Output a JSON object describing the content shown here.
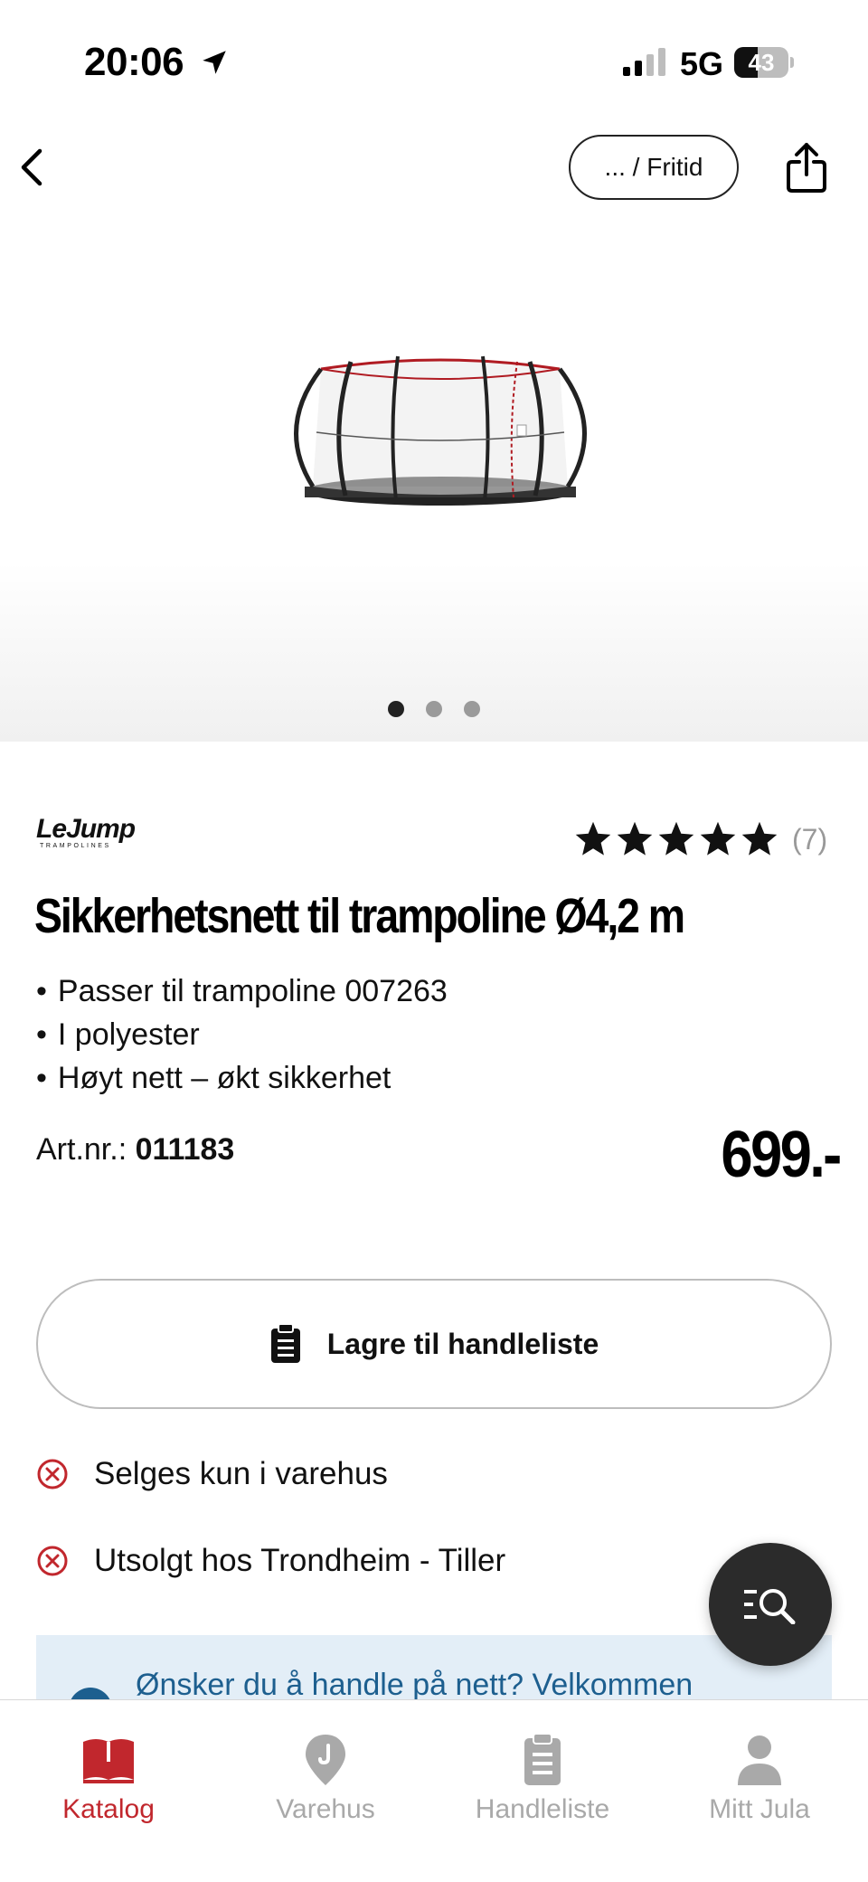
{
  "status_bar": {
    "time": "20:06",
    "network": "5G",
    "battery": "43",
    "battery_level": 0.43
  },
  "header": {
    "breadcrumb": "... / Fritid"
  },
  "gallery": {
    "image_count": 3,
    "active_index": 0
  },
  "product": {
    "brand": "LeJump",
    "brand_sub": "TRAMPOLINES",
    "rating": 5,
    "review_count": "(7)",
    "title": "Sikkerhetsnett til trampoline Ø4,2 m",
    "bullets": [
      "Passer til trampoline 007263",
      "I polyester",
      "Høyt nett – økt sikkerhet"
    ],
    "artnr_label": "Art.nr.:",
    "artnr_value": "011183",
    "price": "699.-"
  },
  "save_button": {
    "label": "Lagre til handleliste"
  },
  "availability": [
    {
      "text": "Selges kun i varehus",
      "status": "unavailable"
    },
    {
      "text": "Utsolgt hos Trondheim - Tiller",
      "status": "unavailable"
    }
  ],
  "info_banner": {
    "text": "Ønsker du å handle på nett? Velkommen"
  },
  "tabs": [
    {
      "label": "Katalog",
      "icon": "book-icon",
      "active": true
    },
    {
      "label": "Varehus",
      "icon": "store-pin-icon",
      "active": false
    },
    {
      "label": "Handleliste",
      "icon": "clipboard-icon",
      "active": false
    },
    {
      "label": "Mitt Jula",
      "icon": "person-icon",
      "active": false
    }
  ],
  "colors": {
    "accent": "#c1272d",
    "info": "#1d5f8f",
    "info_bg": "#e3eef7",
    "inactive": "#a9a9a9",
    "fab": "#2b2b2b"
  }
}
